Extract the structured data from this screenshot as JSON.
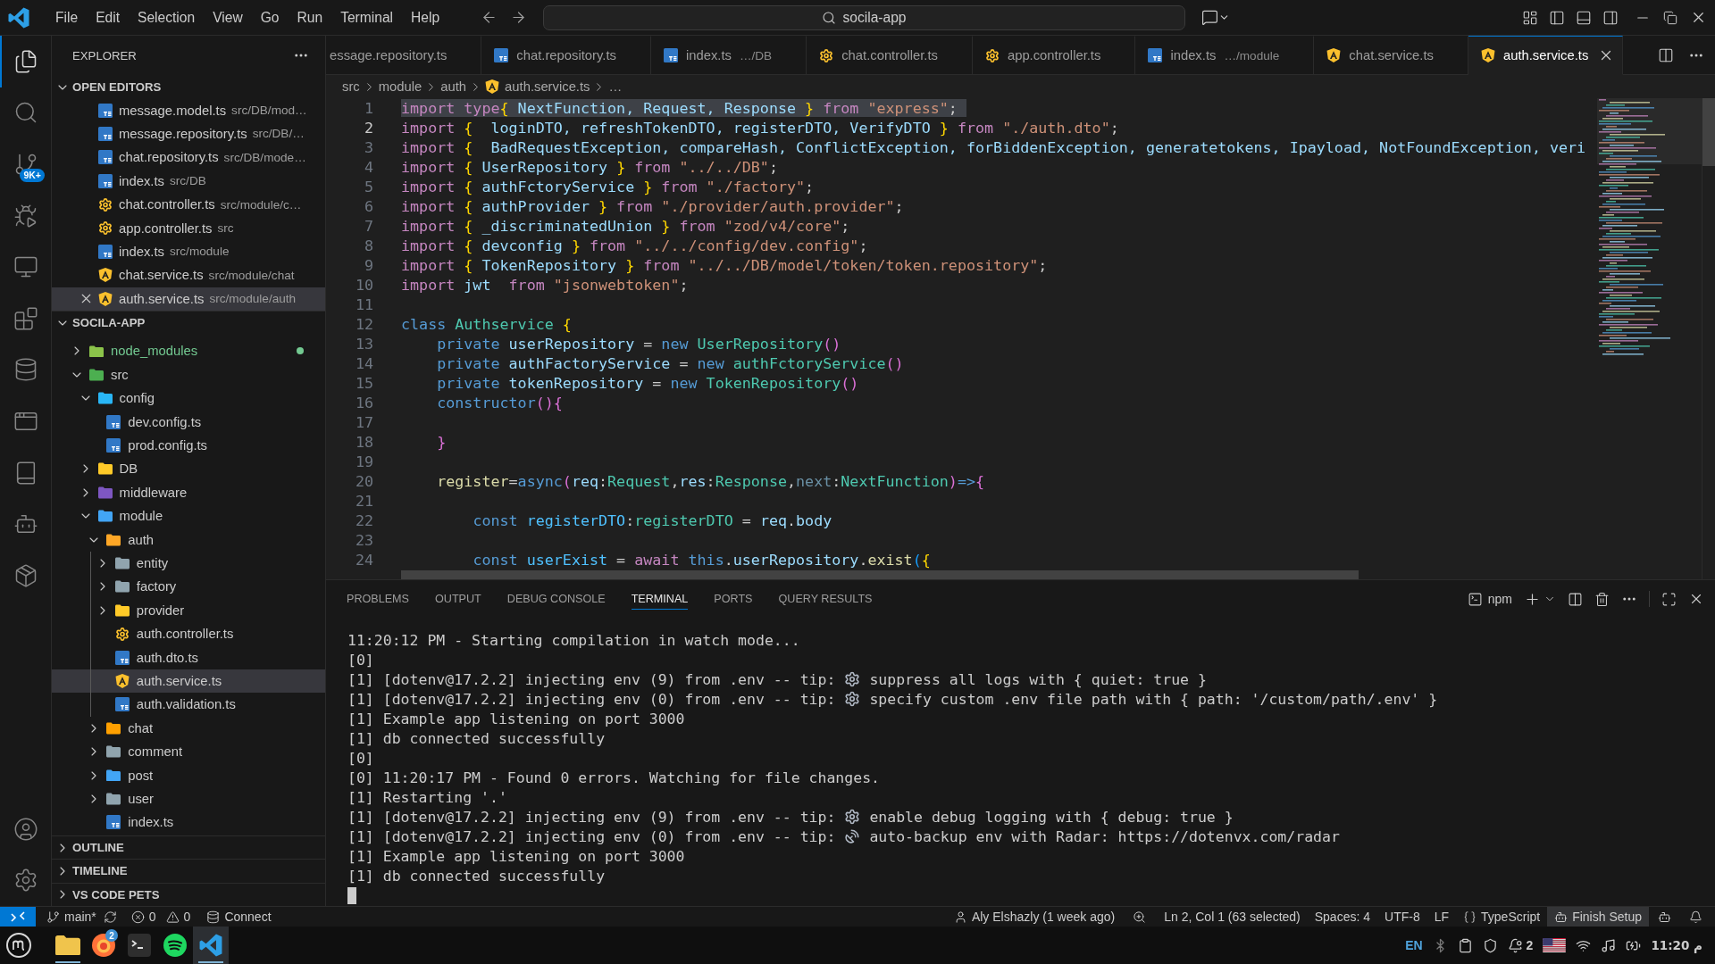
{
  "title_bar": {
    "menu": [
      "File",
      "Edit",
      "Selection",
      "View",
      "Go",
      "Run",
      "Terminal",
      "Help"
    ],
    "command_center": "socila-app"
  },
  "activity_bar": {
    "items": [
      {
        "kind": "explorer",
        "selected": true
      },
      {
        "kind": "search",
        "selected": false
      },
      {
        "kind": "scm",
        "selected": false,
        "badge": "9K+"
      },
      {
        "kind": "run",
        "selected": false
      },
      {
        "kind": "remote",
        "selected": false
      },
      {
        "kind": "extensions",
        "selected": false
      },
      {
        "kind": "database",
        "selected": false
      },
      {
        "kind": "server",
        "selected": false
      },
      {
        "kind": "notebook",
        "selected": false
      },
      {
        "kind": "pets",
        "selected": false
      },
      {
        "kind": "package",
        "selected": false
      }
    ],
    "bottom": [
      {
        "kind": "account"
      },
      {
        "kind": "settings"
      }
    ]
  },
  "sidebar": {
    "title": "EXPLORER",
    "open_editors": {
      "title": "OPEN EDITORS",
      "expanded": true,
      "items": [
        {
          "kind": "typescript",
          "name": "message.model.ts",
          "path": "src/DB/mod…",
          "selected": false
        },
        {
          "kind": "typescript",
          "name": "message.repository.ts",
          "path": "src/DB/…",
          "selected": false
        },
        {
          "kind": "typescript",
          "name": "chat.repository.ts",
          "path": "src/DB/mode…",
          "selected": false
        },
        {
          "kind": "typescript",
          "name": "index.ts",
          "path": "src/DB",
          "selected": false
        },
        {
          "kind": "controller",
          "name": "chat.controller.ts",
          "path": "src/module/c…",
          "selected": false
        },
        {
          "kind": "controller",
          "name": "app.controller.ts",
          "path": "src",
          "selected": false
        },
        {
          "kind": "typescript",
          "name": "index.ts",
          "path": "src/module",
          "selected": false
        },
        {
          "kind": "service",
          "name": "chat.service.ts",
          "path": "src/module/chat",
          "selected": false
        },
        {
          "kind": "service",
          "name": "auth.service.ts",
          "path": "src/module/auth",
          "selected": true
        }
      ]
    },
    "folder": {
      "title": "SOCILA-APP",
      "expanded": true,
      "items": [
        {
          "kind": "folder",
          "name": "node_modules",
          "expanded": false,
          "selected": false,
          "color": "#8bc34a",
          "status": {
            "color": "#73c991"
          }
        },
        {
          "kind": "folder",
          "name": "src",
          "expanded": true,
          "selected": false,
          "color": "#4caf50",
          "children": [
            {
              "kind": "folder",
              "name": "config",
              "expanded": true,
              "selected": false,
              "color": "#29b6f6",
              "children": [
                {
                  "kind": "typescript",
                  "name": "dev.config.ts",
                  "selected": false
                },
                {
                  "kind": "typescript",
                  "name": "prod.config.ts",
                  "selected": false
                }
              ]
            },
            {
              "kind": "folder",
              "name": "DB",
              "expanded": false,
              "selected": false,
              "color": "#ffca28"
            },
            {
              "kind": "folder",
              "name": "middleware",
              "expanded": false,
              "selected": false,
              "color": "#7e57c2"
            },
            {
              "kind": "folder",
              "name": "module",
              "expanded": true,
              "selected": false,
              "color": "#42a5f5",
              "children": [
                {
                  "kind": "folder",
                  "name": "auth",
                  "expanded": true,
                  "selected": false,
                  "color": "#ffa726",
                  "children": [
                    {
                      "kind": "folder",
                      "name": "entity",
                      "expanded": false,
                      "selected": false,
                      "color": "#90a4ae"
                    },
                    {
                      "kind": "folder",
                      "name": "factory",
                      "expanded": false,
                      "selected": false,
                      "color": "#90a4ae"
                    },
                    {
                      "kind": "folder",
                      "name": "provider",
                      "expanded": false,
                      "selected": false,
                      "color": "#ffca28"
                    },
                    {
                      "kind": "controller",
                      "name": "auth.controller.ts",
                      "selected": false
                    },
                    {
                      "kind": "typescript",
                      "name": "auth.dto.ts",
                      "selected": false
                    },
                    {
                      "kind": "service",
                      "name": "auth.service.ts",
                      "selected": true
                    },
                    {
                      "kind": "typescript",
                      "name": "auth.validation.ts",
                      "selected": false
                    }
                  ]
                },
                {
                  "kind": "folder",
                  "name": "chat",
                  "expanded": false,
                  "selected": false,
                  "color": "#ffa000"
                },
                {
                  "kind": "folder",
                  "name": "comment",
                  "expanded": false,
                  "selected": false,
                  "color": "#90a4ae"
                },
                {
                  "kind": "folder",
                  "name": "post",
                  "expanded": false,
                  "selected": false,
                  "color": "#42a5f5"
                },
                {
                  "kind": "folder",
                  "name": "user",
                  "expanded": false,
                  "selected": false,
                  "color": "#90a4ae"
                },
                {
                  "kind": "typescript",
                  "name": "index.ts",
                  "selected": false
                }
              ]
            }
          ]
        }
      ]
    },
    "sections": [
      {
        "title": "OUTLINE",
        "expanded": false
      },
      {
        "title": "TIMELINE",
        "expanded": false
      },
      {
        "title": "VS CODE PETS",
        "expanded": false
      }
    ]
  },
  "tabs": [
    {
      "label": "essage.repository.ts",
      "selected": false
    },
    {
      "kind": "typescript",
      "label": "chat.repository.ts",
      "selected": false
    },
    {
      "kind": "typescript",
      "label": "index.ts",
      "description": "…/DB",
      "selected": false
    },
    {
      "kind": "controller",
      "label": "chat.controller.ts",
      "selected": false
    },
    {
      "kind": "controller",
      "label": "app.controller.ts",
      "selected": false
    },
    {
      "kind": "typescript",
      "label": "index.ts",
      "description": "…/module",
      "selected": false
    },
    {
      "kind": "service",
      "label": "chat.service.ts",
      "selected": false
    },
    {
      "kind": "service",
      "label": "auth.service.ts",
      "selected": true
    }
  ],
  "breadcrumbs": [
    {
      "label": "src"
    },
    {
      "label": "module"
    },
    {
      "label": "auth"
    },
    {
      "kind": "service",
      "label": "auth.service.ts"
    },
    {
      "label": "…"
    }
  ],
  "editor": {
    "lines": [
      {
        "number": "1",
        "selected": true,
        "current": false,
        "tokens": [
          {
            "kind": "keyword",
            "text": "import type"
          },
          {
            "kind": "bracket1",
            "text": "{"
          },
          {
            "kind": "variable",
            "text": " NextFunction, Request, Response "
          },
          {
            "kind": "bracket1",
            "text": "}"
          },
          {
            "kind": "keyword",
            "text": " from "
          },
          {
            "kind": "string",
            "text": "\"express\""
          },
          {
            "kind": "plain",
            "text": ";"
          }
        ]
      },
      {
        "number": "2",
        "selected": false,
        "current": true,
        "tokens": [
          {
            "kind": "keyword",
            "text": "import "
          },
          {
            "kind": "bracket1",
            "text": "{"
          },
          {
            "kind": "variable",
            "text": "  loginDTO, refreshTokenDTO, registerDTO, VerifyDTO "
          },
          {
            "kind": "bracket1",
            "text": "}"
          },
          {
            "kind": "keyword",
            "text": " from "
          },
          {
            "kind": "string",
            "text": "\"./auth.dto\""
          },
          {
            "kind": "plain",
            "text": ";"
          }
        ]
      },
      {
        "number": "3",
        "selected": false,
        "current": false,
        "tokens": [
          {
            "kind": "keyword",
            "text": "import "
          },
          {
            "kind": "bracket1",
            "text": "{"
          },
          {
            "kind": "variable",
            "text": "  BadRequestException, compareHash, ConflictException, forBiddenException, generatetokens, Ipayload, NotFoundException, veri"
          }
        ]
      },
      {
        "number": "4",
        "selected": false,
        "current": false,
        "tokens": [
          {
            "kind": "keyword",
            "text": "import "
          },
          {
            "kind": "bracket1",
            "text": "{"
          },
          {
            "kind": "variable",
            "text": " UserRepository "
          },
          {
            "kind": "bracket1",
            "text": "}"
          },
          {
            "kind": "keyword",
            "text": " from "
          },
          {
            "kind": "string",
            "text": "\"../../DB\""
          },
          {
            "kind": "plain",
            "text": ";"
          }
        ]
      },
      {
        "number": "5",
        "selected": false,
        "current": false,
        "tokens": [
          {
            "kind": "keyword",
            "text": "import "
          },
          {
            "kind": "bracket1",
            "text": "{"
          },
          {
            "kind": "variable",
            "text": " authFctoryService "
          },
          {
            "kind": "bracket1",
            "text": "}"
          },
          {
            "kind": "keyword",
            "text": " from "
          },
          {
            "kind": "string",
            "text": "\"./factory\""
          },
          {
            "kind": "plain",
            "text": ";"
          }
        ]
      },
      {
        "number": "6",
        "selected": false,
        "current": false,
        "tokens": [
          {
            "kind": "keyword",
            "text": "import "
          },
          {
            "kind": "bracket1",
            "text": "{"
          },
          {
            "kind": "variable",
            "text": " authProvider "
          },
          {
            "kind": "bracket1",
            "text": "}"
          },
          {
            "kind": "keyword",
            "text": " from "
          },
          {
            "kind": "string",
            "text": "\"./provider/auth.provider\""
          },
          {
            "kind": "plain",
            "text": ";"
          }
        ]
      },
      {
        "number": "7",
        "selected": false,
        "current": false,
        "tokens": [
          {
            "kind": "keyword",
            "text": "import "
          },
          {
            "kind": "bracket1",
            "text": "{"
          },
          {
            "kind": "variable",
            "text": " _discriminatedUnion "
          },
          {
            "kind": "bracket1",
            "text": "}"
          },
          {
            "kind": "keyword",
            "text": " from "
          },
          {
            "kind": "string",
            "text": "\"zod/v4/core\""
          },
          {
            "kind": "plain",
            "text": ";"
          }
        ]
      },
      {
        "number": "8",
        "selected": false,
        "current": false,
        "tokens": [
          {
            "kind": "keyword",
            "text": "import "
          },
          {
            "kind": "bracket1",
            "text": "{"
          },
          {
            "kind": "variable",
            "text": " devconfig "
          },
          {
            "kind": "bracket1",
            "text": "}"
          },
          {
            "kind": "keyword",
            "text": " from "
          },
          {
            "kind": "string",
            "text": "\"../../config/dev.config\""
          },
          {
            "kind": "plain",
            "text": ";"
          }
        ]
      },
      {
        "number": "9",
        "selected": false,
        "current": false,
        "tokens": [
          {
            "kind": "keyword",
            "text": "import "
          },
          {
            "kind": "bracket1",
            "text": "{"
          },
          {
            "kind": "variable",
            "text": " TokenRepository "
          },
          {
            "kind": "bracket1",
            "text": "}"
          },
          {
            "kind": "keyword",
            "text": " from "
          },
          {
            "kind": "string",
            "text": "\"../../DB/model/token/token.repository\""
          },
          {
            "kind": "plain",
            "text": ";"
          }
        ]
      },
      {
        "number": "10",
        "selected": false,
        "current": false,
        "tokens": [
          {
            "kind": "keyword",
            "text": "import "
          },
          {
            "kind": "variable",
            "text": "jwt  "
          },
          {
            "kind": "keyword",
            "text": "from "
          },
          {
            "kind": "string",
            "text": "\"jsonwebtoken\""
          },
          {
            "kind": "plain",
            "text": ";"
          }
        ]
      },
      {
        "number": "11",
        "selected": false,
        "current": false
      },
      {
        "number": "12",
        "selected": false,
        "current": false,
        "tokens": [
          {
            "kind": "storage",
            "text": "class "
          },
          {
            "kind": "class",
            "text": "Authservice "
          },
          {
            "kind": "bracket1",
            "text": "{"
          }
        ]
      },
      {
        "number": "13",
        "selected": false,
        "current": false,
        "tokens": [
          {
            "kind": "storage",
            "text": "    private "
          },
          {
            "kind": "variable",
            "text": "userRepository"
          },
          {
            "kind": "plain",
            "text": " = "
          },
          {
            "kind": "storage",
            "text": "new "
          },
          {
            "kind": "class",
            "text": "UserRepository"
          },
          {
            "kind": "bracket2",
            "text": "()"
          }
        ]
      },
      {
        "number": "14",
        "selected": false,
        "current": false,
        "tokens": [
          {
            "kind": "storage",
            "text": "    private "
          },
          {
            "kind": "variable",
            "text": "authFactoryService"
          },
          {
            "kind": "plain",
            "text": " = "
          },
          {
            "kind": "storage",
            "text": "new "
          },
          {
            "kind": "class",
            "text": "authFctoryService"
          },
          {
            "kind": "bracket2",
            "text": "()"
          }
        ]
      },
      {
        "number": "15",
        "selected": false,
        "current": false,
        "tokens": [
          {
            "kind": "storage",
            "text": "    private "
          },
          {
            "kind": "variable",
            "text": "tokenRepository"
          },
          {
            "kind": "plain",
            "text": " = "
          },
          {
            "kind": "storage",
            "text": "new "
          },
          {
            "kind": "class",
            "text": "TokenRepository"
          },
          {
            "kind": "bracket2",
            "text": "()"
          }
        ]
      },
      {
        "number": "16",
        "selected": false,
        "current": false,
        "tokens": [
          {
            "kind": "storage",
            "text": "    constructor"
          },
          {
            "kind": "bracket2",
            "text": "(){"
          }
        ]
      },
      {
        "number": "17",
        "selected": false,
        "current": false
      },
      {
        "number": "18",
        "selected": false,
        "current": false,
        "tokens": [
          {
            "kind": "bracket2",
            "text": "    }"
          }
        ]
      },
      {
        "number": "19",
        "selected": false,
        "current": false
      },
      {
        "number": "20",
        "selected": false,
        "current": false,
        "tokens": [
          {
            "kind": "function",
            "text": "    register"
          },
          {
            "kind": "plain",
            "text": "="
          },
          {
            "kind": "storage",
            "text": "async"
          },
          {
            "kind": "bracket2",
            "text": "("
          },
          {
            "kind": "variable",
            "text": "req"
          },
          {
            "kind": "plain",
            "text": ":"
          },
          {
            "kind": "class",
            "text": "Request"
          },
          {
            "kind": "plain",
            "text": ","
          },
          {
            "kind": "variable",
            "text": "res"
          },
          {
            "kind": "plain",
            "text": ":"
          },
          {
            "kind": "class",
            "text": "Response"
          },
          {
            "kind": "plain",
            "text": ","
          },
          {
            "kind": "unused",
            "text": "next"
          },
          {
            "kind": "plain",
            "text": ":"
          },
          {
            "kind": "class",
            "text": "NextFunction"
          },
          {
            "kind": "bracket2",
            "text": ")"
          },
          {
            "kind": "storage",
            "text": "=>"
          },
          {
            "kind": "bracket2",
            "text": "{"
          }
        ]
      },
      {
        "number": "21",
        "selected": false,
        "current": false
      },
      {
        "number": "22",
        "selected": false,
        "current": false,
        "tokens": [
          {
            "kind": "storage",
            "text": "        const "
          },
          {
            "kind": "constant",
            "text": "registerDTO"
          },
          {
            "kind": "plain",
            "text": ":"
          },
          {
            "kind": "class",
            "text": "registerDTO"
          },
          {
            "kind": "plain",
            "text": " = "
          },
          {
            "kind": "variable",
            "text": "req"
          },
          {
            "kind": "plain",
            "text": "."
          },
          {
            "kind": "variable",
            "text": "body"
          }
        ]
      },
      {
        "number": "23",
        "selected": false,
        "current": false
      },
      {
        "number": "24",
        "selected": false,
        "current": false,
        "tokens": [
          {
            "kind": "storage",
            "text": "        const "
          },
          {
            "kind": "constant",
            "text": "userExist"
          },
          {
            "kind": "plain",
            "text": " = "
          },
          {
            "kind": "keyword",
            "text": "await "
          },
          {
            "kind": "storage",
            "text": "this"
          },
          {
            "kind": "plain",
            "text": "."
          },
          {
            "kind": "variable",
            "text": "userRepository"
          },
          {
            "kind": "plain",
            "text": "."
          },
          {
            "kind": "function",
            "text": "exist"
          },
          {
            "kind": "bracket3",
            "text": "("
          },
          {
            "kind": "bracket1",
            "text": "{"
          }
        ]
      }
    ]
  },
  "panel": {
    "tabs": [
      {
        "label": "PROBLEMS",
        "selected": false
      },
      {
        "label": "OUTPUT",
        "selected": false
      },
      {
        "label": "DEBUG CONSOLE",
        "selected": false
      },
      {
        "label": "TERMINAL",
        "selected": true
      },
      {
        "label": "PORTS",
        "selected": false
      },
      {
        "label": "QUERY RESULTS",
        "selected": false
      }
    ],
    "terminal": {
      "profile": "npm",
      "lines": [
        {
          "kind": "plain",
          "text": "11:20:12 PM - Starting compilation in watch mode..."
        },
        {
          "kind": "plain",
          "text": "[0]"
        },
        {
          "kind": "gear",
          "text": "[1] [dotenv@17.2.2] injecting env (9) from .env -- tip:",
          "tip": "suppress all logs with { quiet: true }"
        },
        {
          "kind": "gear",
          "text": "[1] [dotenv@17.2.2] injecting env (0) from .env -- tip:",
          "tip": "specify custom .env file path with { path: '/custom/path/.env' }"
        },
        {
          "kind": "plain",
          "text": "[1] Example app listening on port 3000"
        },
        {
          "kind": "plain",
          "text": "[1] db connected successfully"
        },
        {
          "kind": "plain",
          "text": "[0]"
        },
        {
          "kind": "plain",
          "text": "[0] 11:20:17 PM - Found 0 errors. Watching for file changes."
        },
        {
          "kind": "plain",
          "text": "[1] Restarting '.'"
        },
        {
          "kind": "gear",
          "text": "[1] [dotenv@17.2.2] injecting env (9) from .env -- tip:",
          "tip": "enable debug logging with { debug: true }"
        },
        {
          "kind": "antenna",
          "text": "[1] [dotenv@17.2.2] injecting env (0) from .env -- tip:",
          "tip": "auto-backup env with Radar: https://dotenvx.com/radar"
        },
        {
          "kind": "plain",
          "text": "[1] Example app listening on port 3000"
        },
        {
          "kind": "plain",
          "text": "[1] db connected successfully"
        }
      ]
    }
  },
  "status_bar": {
    "branch": "main*",
    "errors": "0",
    "warnings": "0",
    "connection": "Connect",
    "blame": "Aly Elshazly (1 week ago)",
    "cursor": "Ln 2, Col 1 (63 selected)",
    "indentation": "Spaces: 4",
    "encoding": "UTF-8",
    "line_ending": "LF",
    "language": "TypeScript",
    "setup": "Finish Setup"
  },
  "taskbar": {
    "apps": [
      {
        "kind": "files",
        "running": true,
        "selected": false
      },
      {
        "kind": "browser",
        "running": false,
        "selected": false,
        "badge": "2"
      },
      {
        "kind": "terminal",
        "running": false,
        "selected": false
      },
      {
        "kind": "music",
        "running": false,
        "selected": false
      },
      {
        "kind": "editor",
        "running": true,
        "selected": true
      }
    ],
    "tray": {
      "keyboard": "EN",
      "updates": "2",
      "clock": "م 11:20"
    }
  }
}
